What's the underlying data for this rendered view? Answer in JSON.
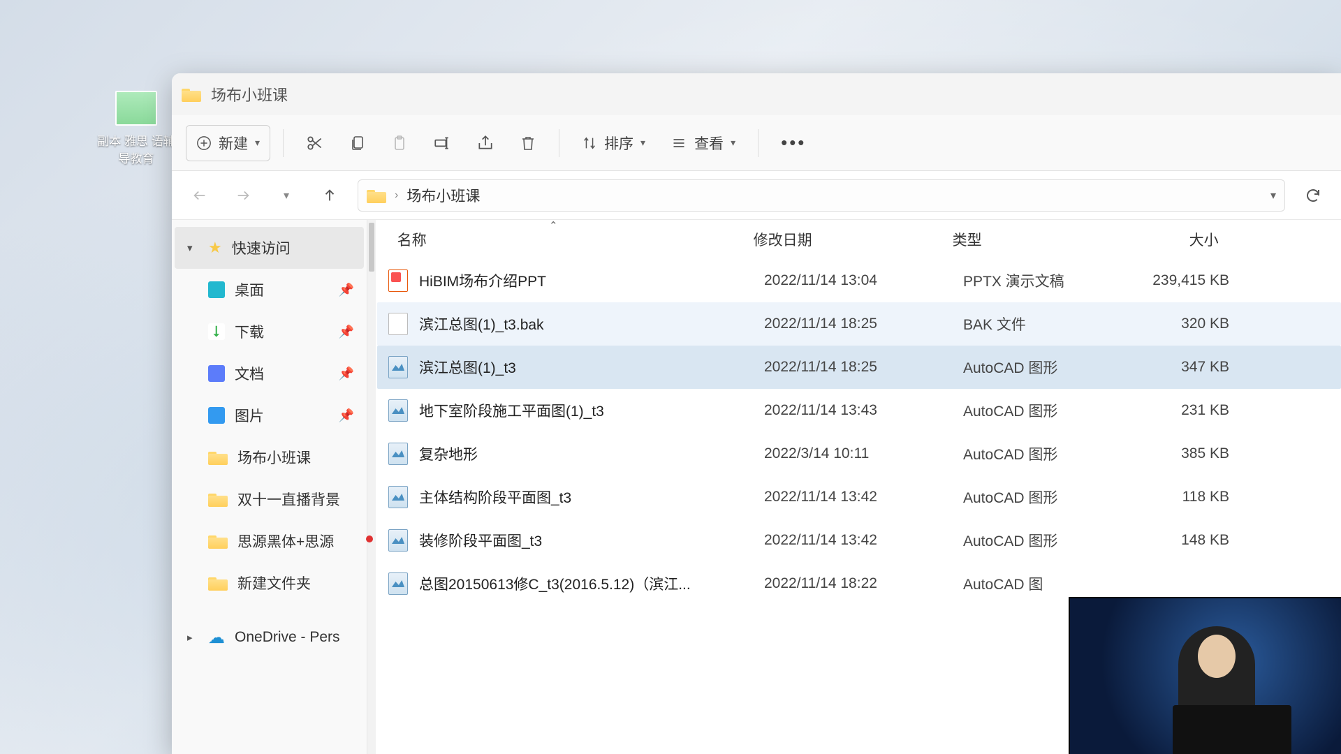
{
  "desktop": {
    "icon_label": "副本 雅思\n语辅导教育"
  },
  "window": {
    "title": "场布小班课"
  },
  "toolbar": {
    "new_label": "新建",
    "sort_label": "排序",
    "view_label": "查看"
  },
  "breadcrumb": {
    "folder": "场布小班课"
  },
  "sidebar": {
    "quick_access": "快速访问",
    "items": [
      {
        "label": "桌面",
        "pin": true,
        "icon": "desktop"
      },
      {
        "label": "下载",
        "pin": true,
        "icon": "download"
      },
      {
        "label": "文档",
        "pin": true,
        "icon": "docs"
      },
      {
        "label": "图片",
        "pin": true,
        "icon": "pics"
      },
      {
        "label": "场布小班课",
        "pin": false,
        "icon": "folder"
      },
      {
        "label": "双十一直播背景",
        "pin": false,
        "icon": "folder"
      },
      {
        "label": "思源黑体+思源",
        "pin": false,
        "icon": "folder"
      },
      {
        "label": "新建文件夹",
        "pin": false,
        "icon": "folder"
      }
    ],
    "onedrive": "OneDrive - Pers"
  },
  "columns": {
    "name": "名称",
    "date": "修改日期",
    "type": "类型",
    "size": "大小"
  },
  "files": [
    {
      "name": "HiBIM场布介绍PPT",
      "date": "2022/11/14 13:04",
      "type": "PPTX 演示文稿",
      "size": "239,415 KB",
      "icon": "ppt",
      "state": ""
    },
    {
      "name": "滨江总图(1)_t3.bak",
      "date": "2022/11/14 18:25",
      "type": "BAK 文件",
      "size": "320 KB",
      "icon": "blank",
      "state": "hover"
    },
    {
      "name": "滨江总图(1)_t3",
      "date": "2022/11/14 18:25",
      "type": "AutoCAD 图形",
      "size": "347 KB",
      "icon": "dwg",
      "state": "selected"
    },
    {
      "name": "地下室阶段施工平面图(1)_t3",
      "date": "2022/11/14 13:43",
      "type": "AutoCAD 图形",
      "size": "231 KB",
      "icon": "dwg",
      "state": ""
    },
    {
      "name": "复杂地形",
      "date": "2022/3/14 10:11",
      "type": "AutoCAD 图形",
      "size": "385 KB",
      "icon": "dwg",
      "state": ""
    },
    {
      "name": "主体结构阶段平面图_t3",
      "date": "2022/11/14 13:42",
      "type": "AutoCAD 图形",
      "size": "118 KB",
      "icon": "dwg",
      "state": ""
    },
    {
      "name": "装修阶段平面图_t3",
      "date": "2022/11/14 13:42",
      "type": "AutoCAD 图形",
      "size": "148 KB",
      "icon": "dwg",
      "state": ""
    },
    {
      "name": "总图20150613修C_t3(2016.5.12)（滨江...",
      "date": "2022/11/14 18:22",
      "type": "AutoCAD 图",
      "size": "",
      "icon": "dwg",
      "state": ""
    }
  ]
}
